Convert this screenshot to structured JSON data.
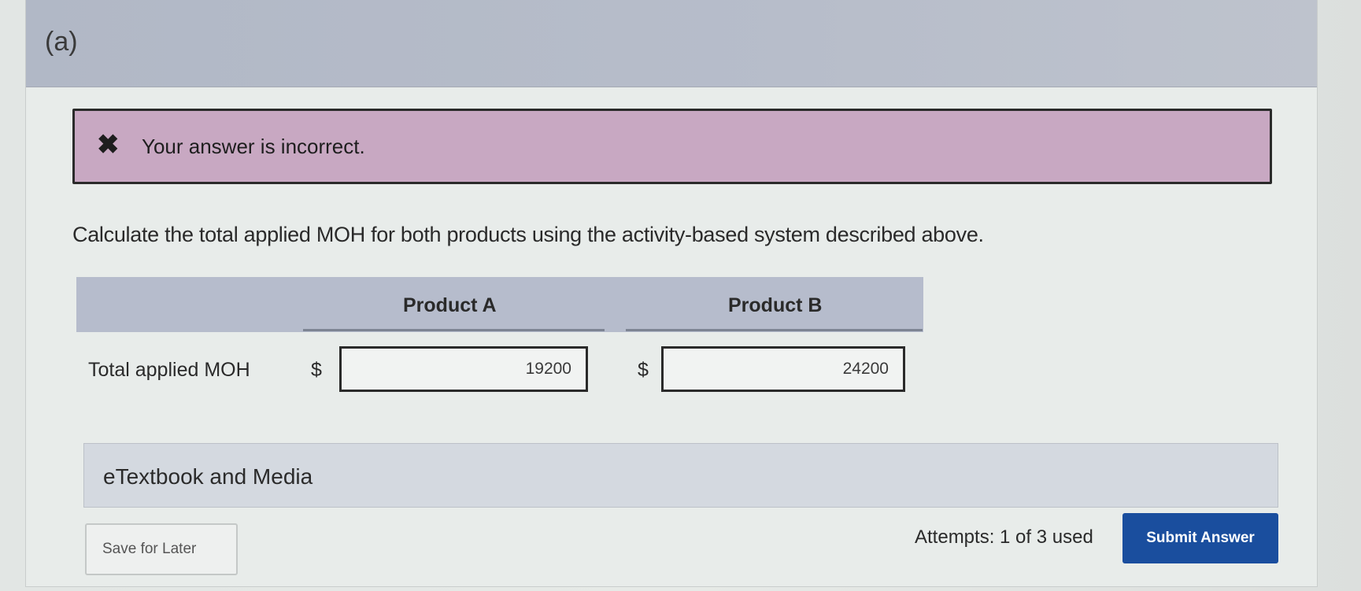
{
  "part": {
    "label": "(a)"
  },
  "alert": {
    "icon": "close-x-icon",
    "glyph": "✖",
    "message": "Your answer is incorrect."
  },
  "question": {
    "text": "Calculate the total applied MOH for both products using the activity-based system described above."
  },
  "table": {
    "columns": [
      "Product A",
      "Product B"
    ],
    "row": {
      "label": "Total applied MOH",
      "currency": "$",
      "values": [
        "19200",
        "24200"
      ]
    }
  },
  "etextbook": {
    "label": "eTextbook and Media"
  },
  "footer": {
    "save_label": "Save for Later",
    "attempts": "Attempts: 1 of 3 used",
    "submit_label": "Submit Answer"
  },
  "colors": {
    "alert_bg": "#c8a8c2",
    "header_bg": "#b1b8c6",
    "submit_bg": "#1a4e9e"
  }
}
